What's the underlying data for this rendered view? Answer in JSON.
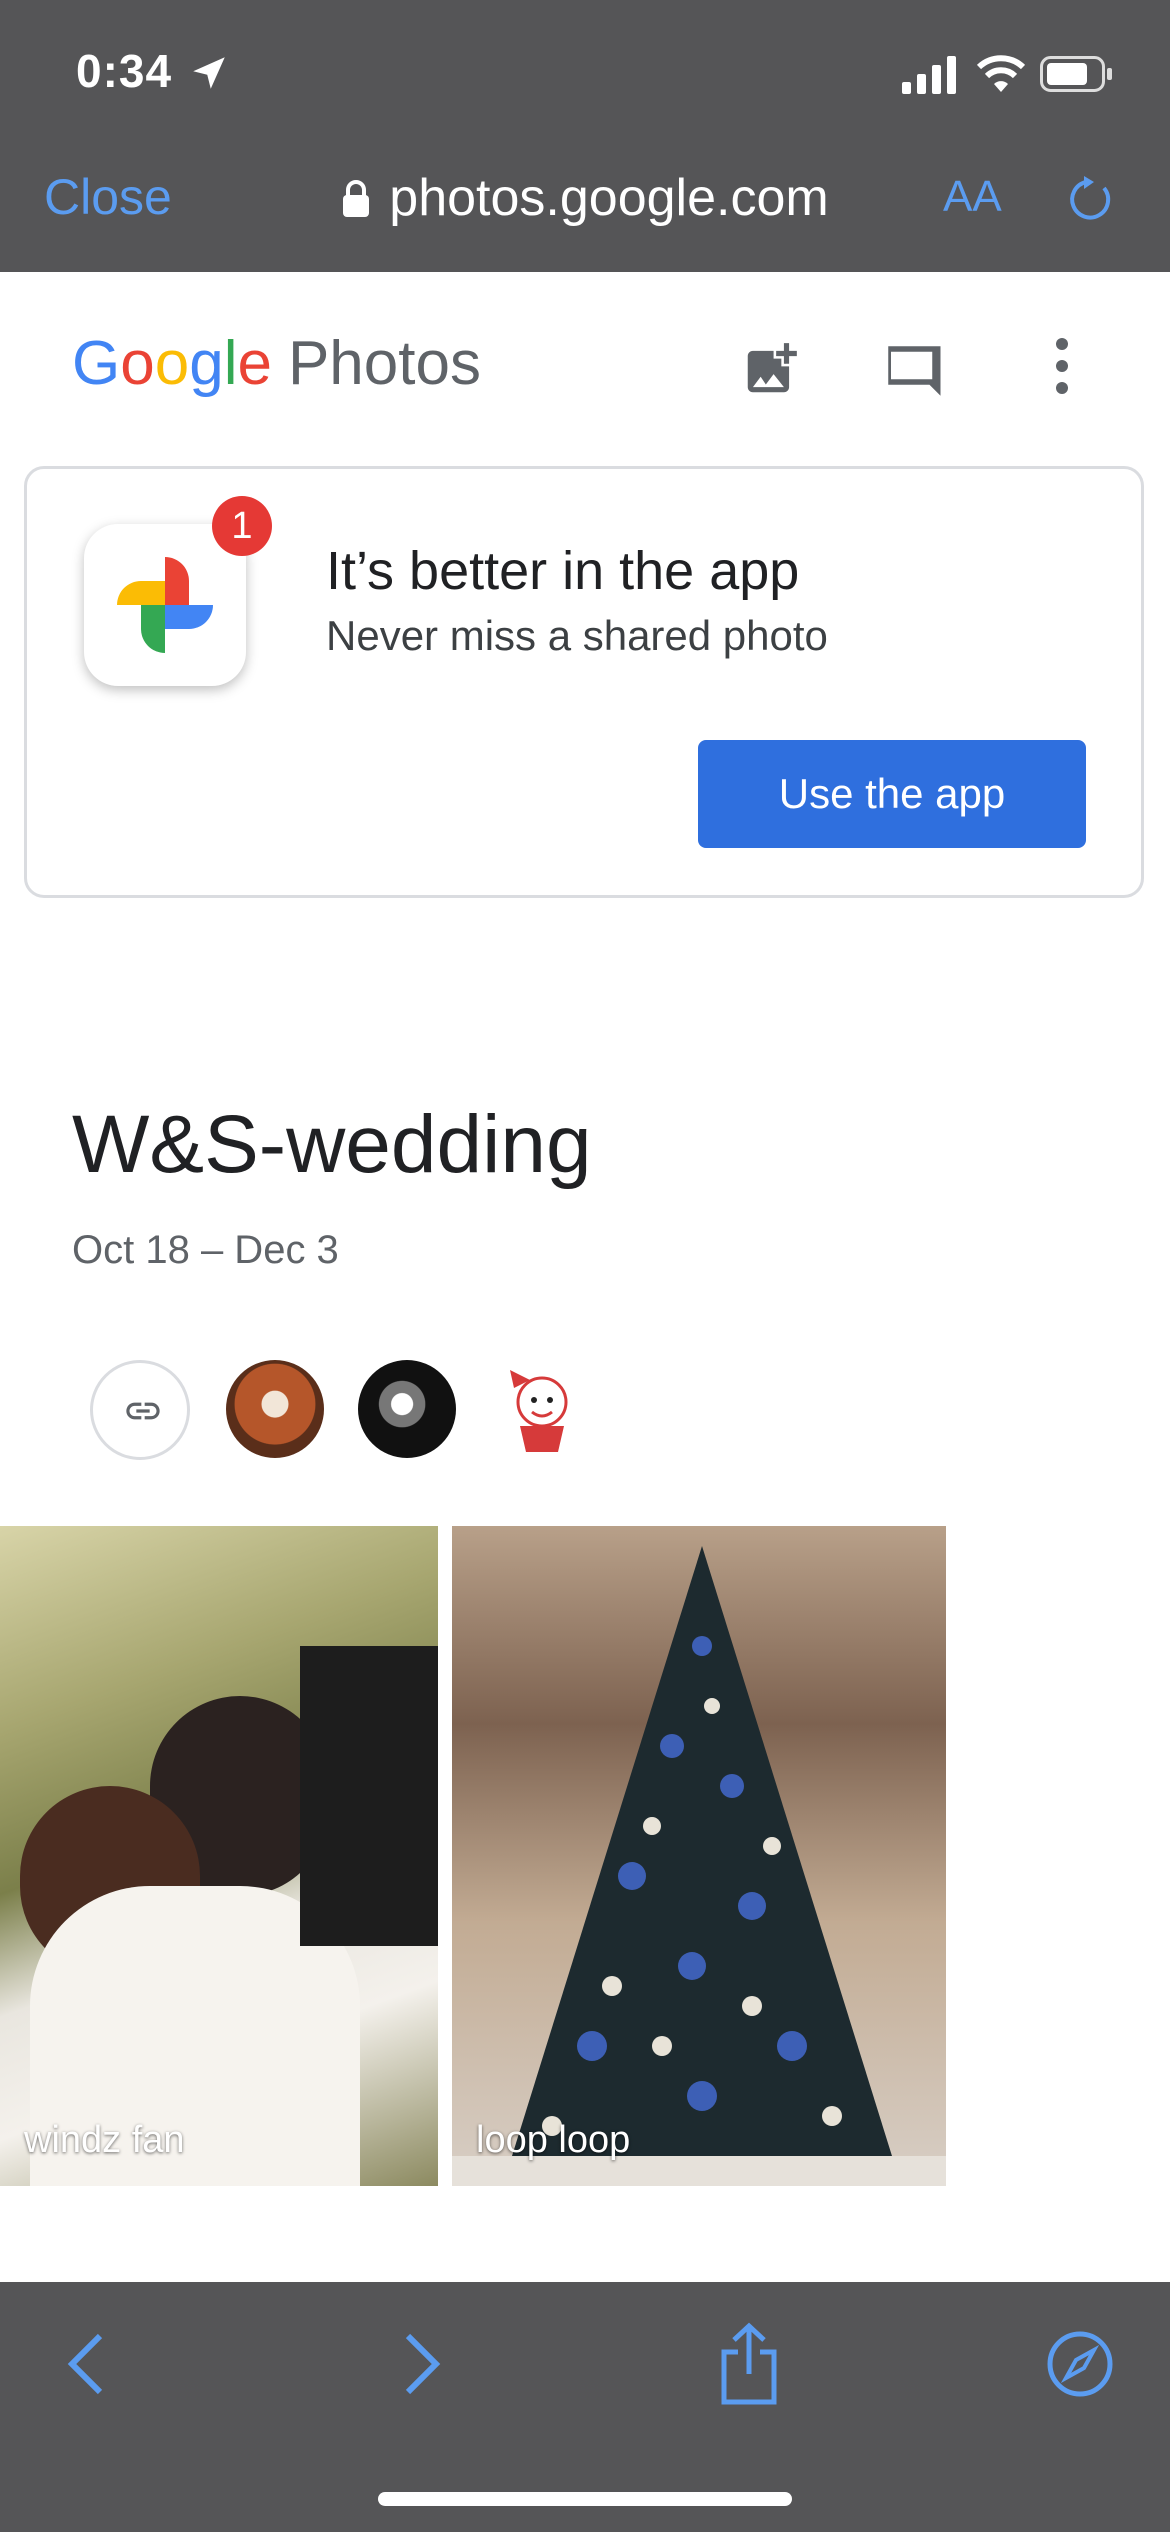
{
  "status_bar": {
    "time": "0:34"
  },
  "browser": {
    "close_label": "Close",
    "url": "photos.google.com",
    "text_size_label": "AA",
    "accent_color": "#5b9cf0"
  },
  "header": {
    "logo_text": "Google",
    "product_name": "Photos"
  },
  "promo": {
    "badge_count": "1",
    "title": "It’s better in the app",
    "subtitle": "Never miss a shared photo",
    "button_label": "Use the app",
    "button_color": "#2f6fde"
  },
  "album": {
    "title": "W&S-wedding",
    "date_range": "Oct 18 – Dec 3",
    "photos": [
      {
        "label": "windz fan"
      },
      {
        "label": "loop loop"
      }
    ]
  }
}
